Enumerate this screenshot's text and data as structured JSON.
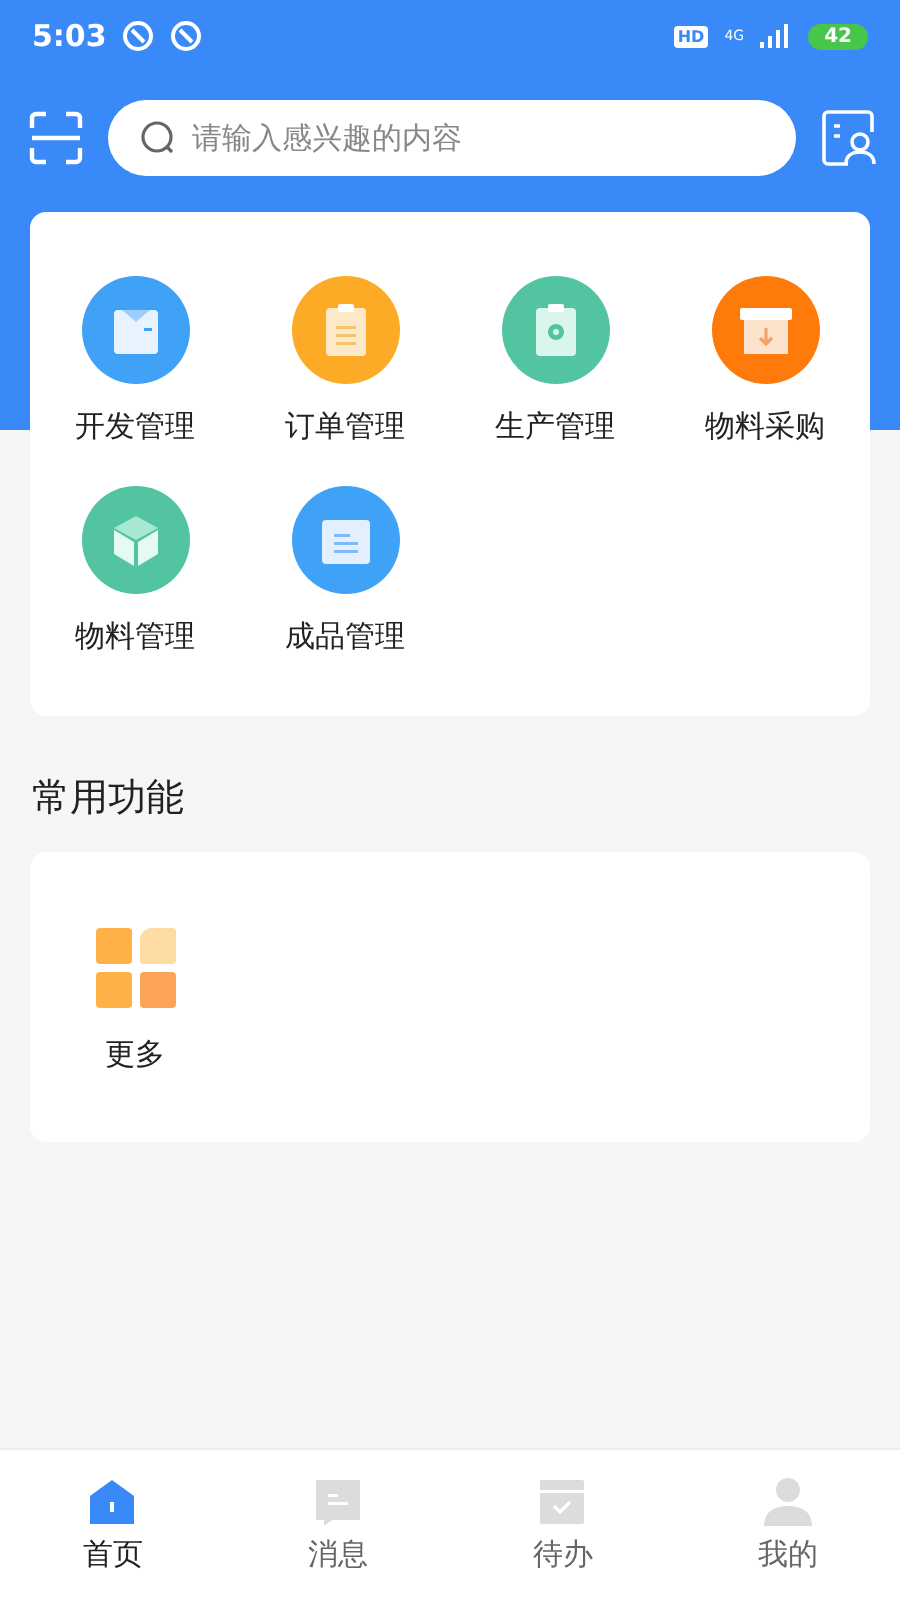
{
  "status_bar": {
    "time": "5:03",
    "hd": "HD",
    "network": "4G",
    "battery": "42"
  },
  "search": {
    "placeholder": "请输入感兴趣的内容"
  },
  "modules": [
    {
      "label": "开发管理",
      "kind": "shirt",
      "color": "#3fa2f7"
    },
    {
      "label": "订单管理",
      "kind": "clipboard",
      "color": "#fdab27"
    },
    {
      "label": "生产管理",
      "kind": "gear-clipboard",
      "color": "#52c4a1"
    },
    {
      "label": "物料采购",
      "kind": "box",
      "color": "#fd7a0b"
    },
    {
      "label": "物料管理",
      "kind": "cube",
      "color": "#52c4a1"
    },
    {
      "label": "成品管理",
      "kind": "tray",
      "color": "#3fa2f7"
    }
  ],
  "section_title": "常用功能",
  "shortcuts": [
    {
      "label": "更多"
    }
  ],
  "tabs": [
    {
      "label": "首页",
      "kind": "home",
      "selected": true
    },
    {
      "label": "消息",
      "kind": "message",
      "selected": false
    },
    {
      "label": "待办",
      "kind": "todo",
      "selected": false
    },
    {
      "label": "我的",
      "kind": "user",
      "selected": false
    }
  ]
}
